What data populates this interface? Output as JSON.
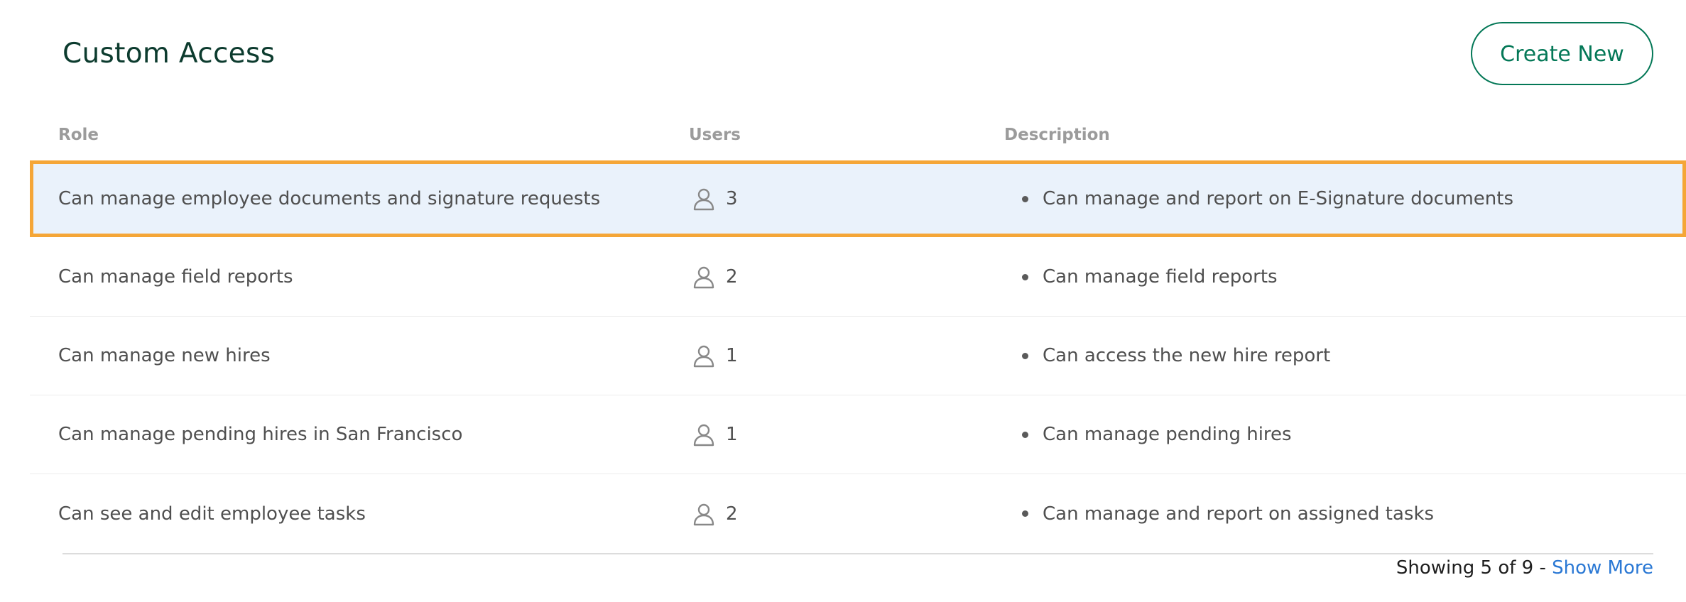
{
  "header": {
    "title": "Custom Access",
    "create_button_label": "Create New"
  },
  "table": {
    "columns": {
      "role": "Role",
      "users": "Users",
      "description": "Description"
    },
    "rows": [
      {
        "role": "Can manage employee documents and signature requests",
        "users": "3",
        "description": "Can manage and report on E-Signature documents",
        "selected": true
      },
      {
        "role": "Can manage field reports",
        "users": "2",
        "description": "Can manage field reports",
        "selected": false
      },
      {
        "role": "Can manage new hires",
        "users": "1",
        "description": "Can access the new hire report",
        "selected": false
      },
      {
        "role": "Can manage pending hires in San Francisco",
        "users": "1",
        "description": "Can manage pending hires",
        "selected": false
      },
      {
        "role": "Can see and edit employee tasks",
        "users": "2",
        "description": "Can manage and report on assigned tasks",
        "selected": false
      }
    ]
  },
  "footer": {
    "showing_text": "Showing 5 of 9 -",
    "show_more_label": "Show More"
  },
  "colors": {
    "brand_green": "#047857",
    "title_green": "#0c3b2e",
    "selection_outline": "#f5a637",
    "selection_fill": "#eaf2fb",
    "link_blue": "#2a78d4"
  },
  "icons": {
    "users_column": "user-icon"
  }
}
